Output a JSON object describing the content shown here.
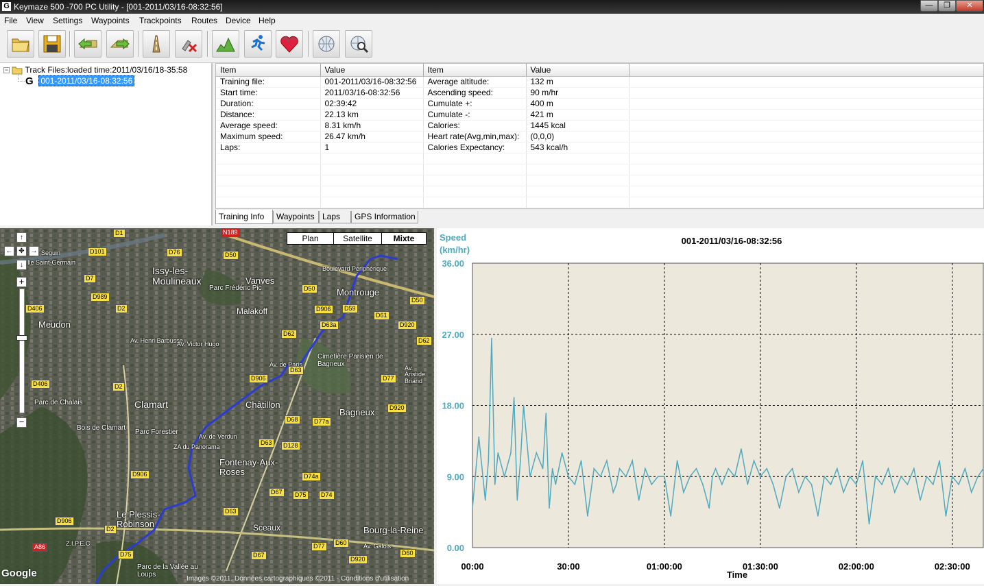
{
  "window": {
    "title": "Keymaze 500 -700 PC Utility - [001-2011/03/16-08:32:56]",
    "controls": {
      "minimize": "—",
      "restore": "❐",
      "close": "✕"
    }
  },
  "menu": [
    "File",
    "View",
    "Settings",
    "Waypoints",
    "Trackpoints",
    "Routes",
    "Device",
    "Help"
  ],
  "toolbar_icons": [
    "open-folder-icon",
    "save-disk-icon",
    "download-arrow-icon",
    "upload-arrow-icon",
    "export-road-icon",
    "delete-tool-icon",
    "altitude-chart-icon",
    "runner-speed-icon",
    "heart-rate-icon",
    "globe-icon",
    "globe-search-icon"
  ],
  "tree": {
    "root_label": "Track Files:loaded time:2011/03/16/18-35:58",
    "selected_item": "001-2011/03/16-08:32:56"
  },
  "info": {
    "headers": [
      "Item",
      "Value",
      "Item",
      "Value"
    ],
    "rows": [
      [
        "Training file:",
        "001-2011/03/16-08:32:56",
        "Average altitude:",
        "132 m"
      ],
      [
        "Start time:",
        "2011/03/16-08:32:56",
        "Ascending speed:",
        "90     m/hr"
      ],
      [
        "Duration:",
        "02:39:42",
        "Cumulate +:",
        "400 m"
      ],
      [
        "Distance:",
        "22.13 km",
        "Cumulate -:",
        "421 m"
      ],
      [
        "Average speed:",
        "8.31 km/h",
        "Calories:",
        "1445 kcal"
      ],
      [
        "Maximum speed:",
        "26.47 km/h",
        "Heart rate(Avg,min,max):",
        "(0,0,0)"
      ],
      [
        "Laps:",
        "1",
        "Calories Expectancy:",
        "543  kcal/h"
      ],
      [
        "",
        "",
        "",
        ""
      ],
      [
        "",
        "",
        "",
        ""
      ],
      [
        "",
        "",
        "",
        ""
      ],
      [
        "",
        "",
        "",
        ""
      ],
      [
        "",
        "",
        "",
        ""
      ]
    ]
  },
  "tabs": [
    "Training Info",
    "Waypoints",
    "Laps",
    "GPS Information"
  ],
  "map": {
    "type_buttons": [
      "Plan",
      "Satellite",
      "Mixte"
    ],
    "active_type": "Mixte",
    "places": [
      "Issy-les-Moulineaux",
      "Vanves",
      "Montrouge",
      "Malakoff",
      "Meudon",
      "Clamart",
      "Châtillon",
      "Bagneux",
      "Fontenay-Aux-Roses",
      "Le Plessis-Robinson",
      "Sceaux",
      "Bourg-la-Reine",
      "Parc Frédéric Pic",
      "Cimetière Parisien de Bagneux",
      "Bois de Clamart",
      "Parc Forestier",
      "Parc de Chalais",
      "Parc de la Vallée au Loups",
      "Seguin",
      "Ile Saint-Germain",
      "Boulevard Périphérique",
      "Av. Henri Barbusse",
      "Av. Victor Hugo",
      "Av. de Verdun",
      "Av. de Paris",
      "Z.I.P.E.C",
      "ZA du Panorama",
      "Av. Aristide Briand",
      "Av. Galois"
    ],
    "roads": [
      "D1",
      "N189",
      "D101",
      "D76",
      "D50",
      "D7",
      "D989",
      "D406",
      "D2",
      "D50",
      "D906",
      "D59",
      "D61",
      "D920",
      "D62",
      "D63a",
      "D62",
      "D50",
      "D63",
      "D77",
      "D406",
      "D906",
      "D68",
      "D77a",
      "D920",
      "D63",
      "D128",
      "D2",
      "D906",
      "D74a",
      "D67",
      "D75",
      "D74",
      "D63",
      "D906",
      "D2",
      "D77",
      "D60",
      "D75",
      "D67",
      "D60",
      "D920",
      "A86"
    ],
    "copyright": "Images ©2011, Données cartographiques ©2011 - Conditions d'utilisation",
    "logo": "Google"
  },
  "chart_data": {
    "type": "line",
    "title": "001-2011/03/16-08:32:56",
    "ylabel": "Speed (km/hr)",
    "xlabel": "Time",
    "ylim": [
      0,
      36
    ],
    "xlim": [
      "00:00",
      "02:39:42"
    ],
    "yticks": [
      "36.00",
      "27.00",
      "18.00",
      "9.00",
      "0.00"
    ],
    "xticks": [
      "00:00",
      "30:00",
      "01:00:00",
      "01:30:00",
      "02:00:00",
      "02:30:00"
    ],
    "grid": true,
    "background_color": "#ece8db",
    "line_color": "#4fa9bf",
    "series": [
      {
        "x_minutes": [
          0,
          2,
          4,
          5,
          6,
          7,
          8,
          10,
          12,
          13,
          14,
          15,
          16,
          18,
          20,
          22,
          23,
          24,
          25,
          26,
          28,
          30,
          32,
          34,
          36,
          38,
          40,
          42,
          44,
          45,
          46,
          48,
          50,
          52,
          54,
          56,
          58,
          60,
          62,
          64,
          66,
          68,
          70,
          72,
          74,
          75,
          76,
          78,
          80,
          82,
          84,
          86,
          88,
          90,
          92,
          94,
          96,
          98,
          100,
          102,
          104,
          106,
          108,
          110,
          112,
          114,
          116,
          118,
          120,
          122,
          124,
          126,
          128,
          130,
          132,
          134,
          136,
          138,
          140,
          142,
          144,
          146,
          148,
          150,
          152,
          154,
          156,
          158,
          159.7
        ],
        "values": [
          5,
          14,
          6,
          11,
          26.5,
          8,
          12,
          9,
          12,
          19,
          6,
          11,
          18,
          9,
          12,
          10,
          17,
          5,
          10,
          8,
          12,
          9,
          8,
          11,
          4,
          10,
          9,
          11,
          7,
          8,
          10,
          9,
          11,
          6,
          10,
          8,
          9,
          9,
          4,
          11,
          7,
          9,
          10,
          8,
          5,
          9,
          10,
          8,
          10,
          9,
          12.5,
          8,
          11,
          9,
          10,
          8,
          5,
          9,
          10,
          7,
          9,
          8,
          4,
          9,
          8,
          10,
          7,
          9,
          8,
          11,
          3,
          9,
          8,
          10,
          7,
          9,
          8,
          10,
          6,
          9,
          8,
          11,
          4,
          9,
          8,
          10,
          7,
          9,
          10
        ]
      }
    ]
  }
}
